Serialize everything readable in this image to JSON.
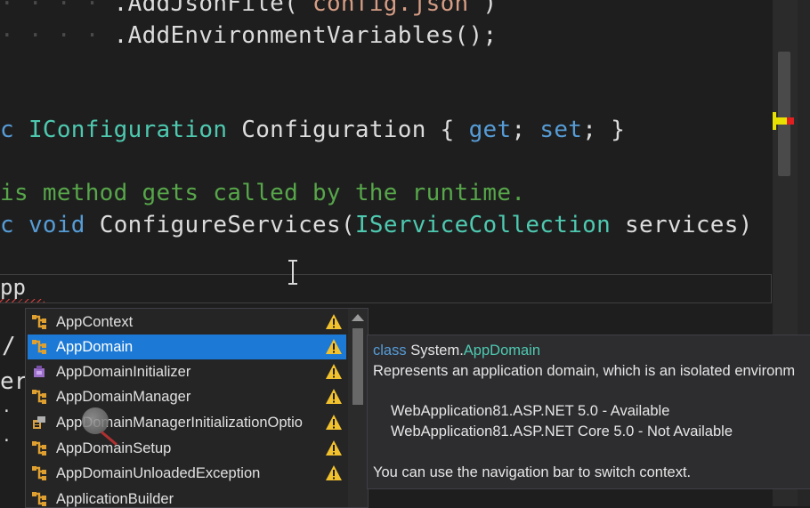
{
  "editor": {
    "lines": {
      "l1": {
        "method": ".AddJsonFile(",
        "string": "\"config.json\"",
        "end": ")"
      },
      "l2": {
        "method": ".AddEnvironmentVariables();"
      },
      "l3": {
        "prefix": "c",
        "type": "IConfiguration",
        "name": "Configuration",
        "open": "{",
        "get": "get",
        "semi1": ";",
        "set": "set",
        "semi2": ";",
        "close": "}"
      },
      "l4": {
        "comment": "is method gets called by the runtime."
      },
      "l5": {
        "prefix": "c",
        "kw_void": "void",
        "method": "ConfigureServices(",
        "type": "IServiceCollection",
        "param": "services)"
      },
      "l6": {
        "typed": "pp"
      },
      "l7": {
        "text": "/"
      },
      "l8": {
        "text": "er"
      }
    },
    "colors": {
      "keyword": "#569cd6",
      "type": "#4ec9b0",
      "string": "#d69d85",
      "comment": "#57a64a",
      "selection": "#1c7ad6"
    }
  },
  "completion": {
    "items": [
      {
        "label": "AppContext",
        "icon": "class-icon"
      },
      {
        "label": "AppDomain",
        "icon": "class-icon",
        "selected": true
      },
      {
        "label": "AppDomainInitializer",
        "icon": "delegate-icon"
      },
      {
        "label": "AppDomainManager",
        "icon": "class-icon"
      },
      {
        "label": "AppDomainManagerInitializationOptio",
        "icon": "enum-icon"
      },
      {
        "label": "AppDomainSetup",
        "icon": "class-icon"
      },
      {
        "label": "AppDomainUnloadedException",
        "icon": "class-icon"
      },
      {
        "label": "ApplicationBuilder",
        "icon": "class-icon"
      }
    ]
  },
  "tooltip": {
    "kind": "class",
    "namespace": "System.",
    "type": "AppDomain",
    "description": "Represents an application domain, which is an isolated environm",
    "availability1": "WebApplication81.ASP.NET 5.0 - Available",
    "availability2": "WebApplication81.ASP.NET Core 5.0 - Not Available",
    "hint": "You can use the navigation bar to switch context."
  }
}
